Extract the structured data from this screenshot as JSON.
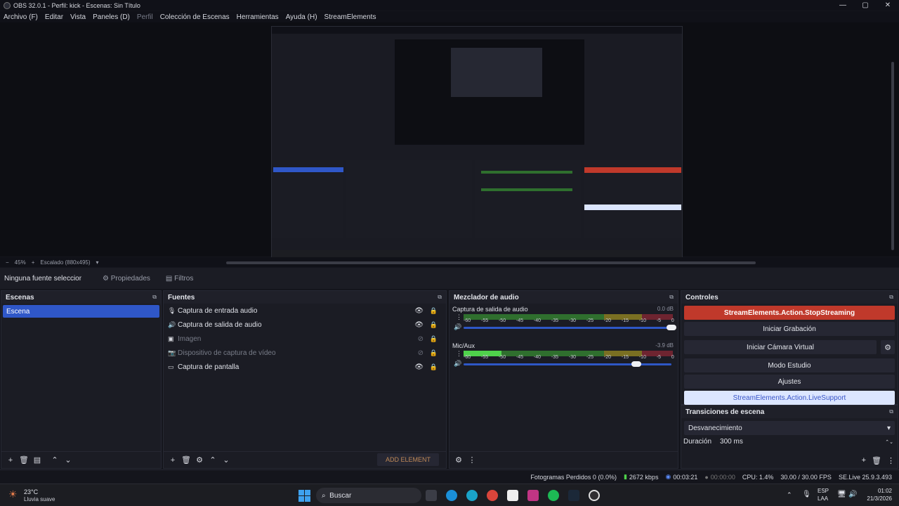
{
  "window": {
    "title": "OBS 32.0.1 - Perfil: kick - Escenas: Sin Título",
    "minimize": "—",
    "maximize": "▢",
    "close": "✕"
  },
  "menu": [
    "Archivo (F)",
    "Editar",
    "Vista",
    "Paneles (D)",
    "Perfil",
    "Colección de Escenas",
    "Herramientas",
    "Ayuda (H)",
    "StreamElements"
  ],
  "preview_bar": {
    "zoom_out": "−",
    "zoom": "45%",
    "zoom_in": "+",
    "scale": "Escalado (880x495)"
  },
  "context_bar": {
    "label": "Ninguna fuente seleccionada",
    "properties": "Propiedades",
    "filters": "Filtros"
  },
  "scenes": {
    "title": "Escenas",
    "items": [
      "Escena"
    ]
  },
  "sources": {
    "title": "Fuentes",
    "add_element": "ADD ELEMENT",
    "items": [
      {
        "name": "Captura de entrada audio",
        "icon": "microphone-icon",
        "visible": true
      },
      {
        "name": "Captura de salida de audio",
        "icon": "speaker-icon",
        "visible": true
      },
      {
        "name": "Imagen",
        "icon": "image-icon",
        "visible": false
      },
      {
        "name": "Dispositivo de captura de vídeo",
        "icon": "camera-icon",
        "visible": false
      },
      {
        "name": "Captura de pantalla",
        "icon": "monitor-icon",
        "visible": true
      }
    ]
  },
  "mixer": {
    "title": "Mezclador de audio",
    "ticks": [
      "-60",
      "-55",
      "-50",
      "-45",
      "-40",
      "-35",
      "-30",
      "-25",
      "-20",
      "-15",
      "-10",
      "-5",
      "0"
    ],
    "channels": [
      {
        "name": "Captura de salida de audio",
        "db": "0.0 dB",
        "level": 0,
        "volume": 1.0
      },
      {
        "name": "Mic/Aux",
        "db": "-3.9 dB",
        "level": 0.18,
        "volume": 0.83
      }
    ]
  },
  "controls": {
    "title": "Controles",
    "stop_streaming": "StreamElements.Action.StopStreaming",
    "start_recording": "Iniciar Grabación",
    "virtual_camera": "Iniciar Cámara Virtual",
    "studio_mode": "Modo Estudio",
    "settings": "Ajustes",
    "live_support": "StreamElements.Action.LiveSupport"
  },
  "transitions": {
    "title": "Transiciones de escena",
    "selected": "Desvanecimiento",
    "duration_label": "Duración",
    "duration_value": "300 ms"
  },
  "status": {
    "dropped": "Fotogramas Perdidos 0 (0.0%)",
    "bitrate": "2672 kbps",
    "stream_time": "00:03:21",
    "rec_time": "00:00:00",
    "cpu": "CPU: 1.4%",
    "fps": "30.00 / 30.00 FPS",
    "se_version": "SE.Live 25.9.3.493"
  },
  "taskbar": {
    "temp": "23°C",
    "weather": "Lluvia suave",
    "search": "Buscar",
    "lang": "ESP",
    "layout": "LAA",
    "time": "01:02",
    "date": "21/3/2026"
  },
  "colors": {
    "accent": "#2f57c8",
    "stop": "#c0392b",
    "live_bg": "#dce6ff"
  }
}
